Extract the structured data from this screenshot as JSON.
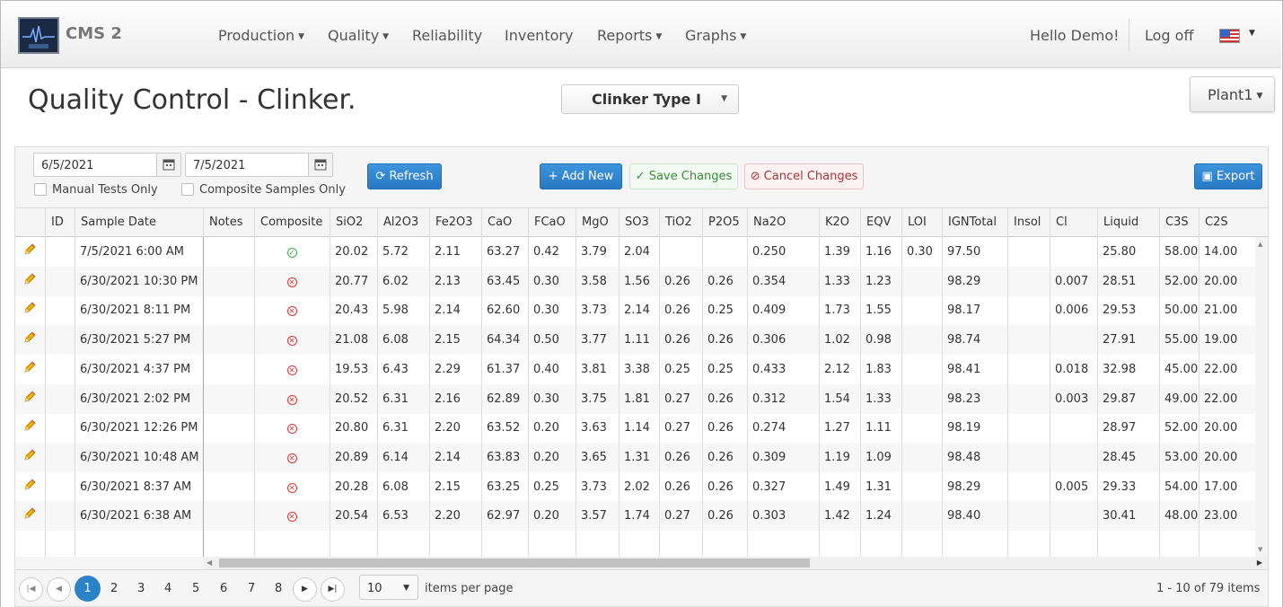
{
  "app": {
    "title": "CMS 2"
  },
  "nav": {
    "items": [
      "Production",
      "Quality",
      "Reliability",
      "Inventory",
      "Reports",
      "Graphs"
    ],
    "greeting": "Hello Demo!",
    "logoff": "Log off"
  },
  "page": {
    "title": "Quality Control - Clinker.",
    "clinker_type": "Clinker Type I",
    "plant": "Plant1"
  },
  "toolbar": {
    "date_from": "6/5/2021",
    "date_to": "7/5/2021",
    "manual_label": "Manual Tests Only",
    "composite_label": "Composite Samples Only",
    "refresh": "Refresh",
    "add_new": "Add New",
    "save": "Save Changes",
    "cancel": "Cancel Changes",
    "export": "Export"
  },
  "table": {
    "columns": [
      "ID",
      "Sample Date",
      "Notes",
      "Composite",
      "SiO2",
      "Al2O3",
      "Fe2O3",
      "CaO",
      "FCaO",
      "MgO",
      "SO3",
      "TiO2",
      "P2O5",
      "Na2O",
      "K2O",
      "EQV",
      "LOI",
      "IGNTotal",
      "Insol",
      "Cl",
      "Liquid",
      "C3S",
      "C2S"
    ],
    "rows": [
      [
        "",
        "7/5/2021 6:00 AM",
        "",
        "yes",
        "20.02",
        "5.72",
        "2.11",
        "63.27",
        "0.42",
        "3.79",
        "2.04",
        "",
        "",
        "0.250",
        "1.39",
        "1.16",
        "0.30",
        "97.50",
        "",
        "",
        "25.80",
        "58.00",
        "14.00"
      ],
      [
        "",
        "6/30/2021 10:30 PM",
        "",
        "no",
        "20.77",
        "6.02",
        "2.13",
        "63.45",
        "0.30",
        "3.58",
        "1.56",
        "0.26",
        "0.26",
        "0.354",
        "1.33",
        "1.23",
        "",
        "98.29",
        "",
        "0.007",
        "28.51",
        "52.00",
        "20.00"
      ],
      [
        "",
        "6/30/2021 8:11 PM",
        "",
        "no",
        "20.43",
        "5.98",
        "2.14",
        "62.60",
        "0.30",
        "3.73",
        "2.14",
        "0.26",
        "0.25",
        "0.409",
        "1.73",
        "1.55",
        "",
        "98.17",
        "",
        "0.006",
        "29.53",
        "50.00",
        "21.00"
      ],
      [
        "",
        "6/30/2021 5:27 PM",
        "",
        "no",
        "21.08",
        "6.08",
        "2.15",
        "64.34",
        "0.50",
        "3.77",
        "1.11",
        "0.26",
        "0.26",
        "0.306",
        "1.02",
        "0.98",
        "",
        "98.74",
        "",
        "",
        "27.91",
        "55.00",
        "19.00"
      ],
      [
        "",
        "6/30/2021 4:37 PM",
        "",
        "no",
        "19.53",
        "6.43",
        "2.29",
        "61.37",
        "0.40",
        "3.81",
        "3.38",
        "0.25",
        "0.25",
        "0.433",
        "2.12",
        "1.83",
        "",
        "98.41",
        "",
        "0.018",
        "32.98",
        "45.00",
        "22.00"
      ],
      [
        "",
        "6/30/2021 2:02 PM",
        "",
        "no",
        "20.52",
        "6.31",
        "2.16",
        "62.89",
        "0.30",
        "3.75",
        "1.81",
        "0.27",
        "0.26",
        "0.312",
        "1.54",
        "1.33",
        "",
        "98.23",
        "",
        "0.003",
        "29.87",
        "49.00",
        "22.00"
      ],
      [
        "",
        "6/30/2021 12:26 PM",
        "",
        "no",
        "20.80",
        "6.31",
        "2.20",
        "63.52",
        "0.20",
        "3.63",
        "1.14",
        "0.27",
        "0.26",
        "0.274",
        "1.27",
        "1.11",
        "",
        "98.19",
        "",
        "",
        "28.97",
        "52.00",
        "20.00"
      ],
      [
        "",
        "6/30/2021 10:48 AM",
        "",
        "no",
        "20.89",
        "6.14",
        "2.14",
        "63.83",
        "0.20",
        "3.65",
        "1.31",
        "0.26",
        "0.26",
        "0.309",
        "1.19",
        "1.09",
        "",
        "98.48",
        "",
        "",
        "28.45",
        "53.00",
        "20.00"
      ],
      [
        "",
        "6/30/2021 8:37 AM",
        "",
        "no",
        "20.28",
        "6.08",
        "2.15",
        "63.25",
        "0.25",
        "3.73",
        "2.02",
        "0.26",
        "0.26",
        "0.327",
        "1.49",
        "1.31",
        "",
        "98.29",
        "",
        "0.005",
        "29.33",
        "54.00",
        "17.00"
      ],
      [
        "",
        "6/30/2021 6:38 AM",
        "",
        "no",
        "20.54",
        "6.53",
        "2.20",
        "62.97",
        "0.20",
        "3.57",
        "1.74",
        "0.27",
        "0.26",
        "0.303",
        "1.42",
        "1.24",
        "",
        "98.40",
        "",
        "",
        "30.41",
        "48.00",
        "23.00"
      ]
    ]
  },
  "pager": {
    "pages": [
      "1",
      "2",
      "3",
      "4",
      "5",
      "6",
      "7",
      "8"
    ],
    "current": "1",
    "page_size": "10",
    "per_page_label": "items per page",
    "info": "1 - 10 of 79 items"
  }
}
